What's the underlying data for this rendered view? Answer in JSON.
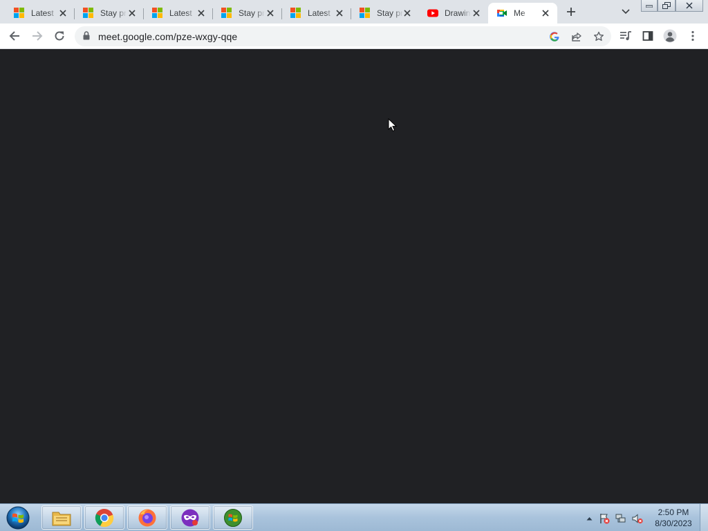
{
  "browser": {
    "tabs": [
      {
        "title": "Latest",
        "favicon": "microsoft-icon",
        "active": false
      },
      {
        "title": "Stay pr",
        "favicon": "microsoft-icon",
        "active": false
      },
      {
        "title": "Latest",
        "favicon": "microsoft-icon",
        "active": false
      },
      {
        "title": "Stay pr",
        "favicon": "microsoft-icon",
        "active": false
      },
      {
        "title": "Latest",
        "favicon": "microsoft-icon",
        "active": false
      },
      {
        "title": "Stay pr",
        "favicon": "microsoft-icon",
        "active": false
      },
      {
        "title": "Drawin",
        "favicon": "youtube-icon",
        "active": false
      },
      {
        "title": "Me",
        "favicon": "google-meet-icon",
        "active": true
      }
    ],
    "url": "meet.google.com/pze-wxgy-qqe"
  },
  "content": {
    "background_color": "#202124"
  },
  "taskbar": {
    "apps": [
      "windows-explorer-icon",
      "chrome-icon",
      "firefox-icon",
      "vpn-mask-icon",
      "windows-media-icon"
    ],
    "clock_time": "2:50 PM",
    "clock_date": "8/30/2023"
  },
  "colors": {
    "tabstrip": "#dfe3e8",
    "toolbar": "#ffffff",
    "omnibox": "#f1f3f4",
    "taskbar": "#a9c3dc"
  }
}
